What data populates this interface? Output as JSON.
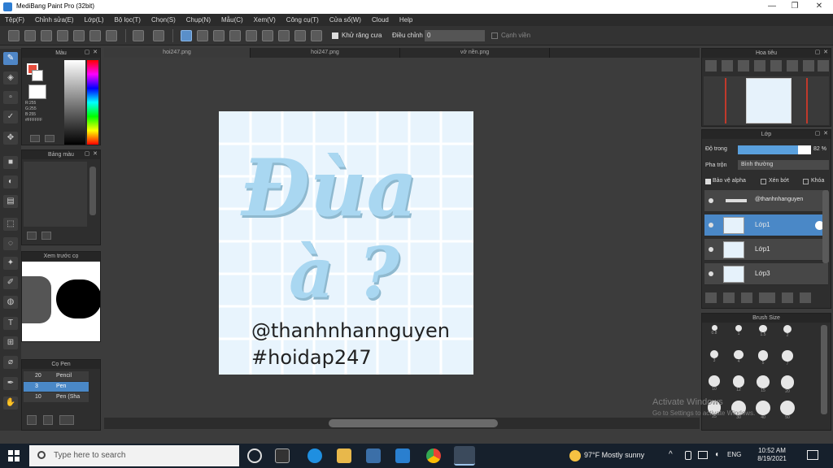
{
  "window": {
    "title": "MediBang Paint Pro (32bit)",
    "controls": [
      "—",
      "❐",
      "✕"
    ]
  },
  "menu": [
    "Tệp(F)",
    "Chỉnh sửa(E)",
    "Lớp(L)",
    "Bộ lọc(T)",
    "Chọn(S)",
    "Chụp(N)",
    "Mẫu(C)",
    "Xem(V)",
    "Công cụ(T)",
    "Cửa sổ(W)",
    "Cloud",
    "Help"
  ],
  "toolbar": {
    "fill_label": "Khử răng cưa",
    "correction_label": "Điều chỉnh",
    "correction_value": "0",
    "stroke_label": "Cạnh viền"
  },
  "tabs": [
    "hoi247.png",
    "hoi247.png",
    "vở nền.png"
  ],
  "color_panel": {
    "title": "Màu",
    "codes": [
      "R:255",
      "G:255",
      "B:255",
      "#FFFFFF"
    ]
  },
  "swatch_panel": {
    "title": "Bảng màu"
  },
  "preview_panel": {
    "title": "Xem trước cọ"
  },
  "brush_panel": {
    "title": "Cọ Pen",
    "items": [
      {
        "size": "20",
        "name": "Pencil"
      },
      {
        "size": "3",
        "name": "Pen"
      },
      {
        "size": "10",
        "name": "Pen (Sha"
      }
    ]
  },
  "navigator_panel": {
    "title": "Hoa tiêu"
  },
  "layer_panel": {
    "title": "Lớp",
    "opacity_label": "Độ trong",
    "opacity_value": "82 %",
    "opacity": 0.82,
    "blend_label": "Pha trộn",
    "blend_value": "Bình thường",
    "checks": [
      "Bảo vệ alpha",
      "Xén bớt",
      "Khóa"
    ],
    "layers": [
      "@thanhnhanguyen",
      "Lớp1",
      "Lớp1",
      "Lớp3"
    ]
  },
  "brush_size_panel": {
    "title": "Brush Size",
    "sizes": [
      "0.8",
      "1",
      "1.5",
      "2",
      "3",
      "4",
      "5",
      "7",
      "10",
      "12",
      "15",
      "20",
      "25",
      "30",
      "40",
      "50"
    ]
  },
  "canvas": {
    "word1": "Đùa",
    "word2": "à ?",
    "handle": "@thanhnhannguyen",
    "hashtag": "#hoidap247"
  },
  "watermark": {
    "line1": "Activate Windows",
    "line2": "Go to Settings to activate Windows."
  },
  "taskbar": {
    "search_placeholder": "Type here to search",
    "weather": "97°F  Mostly sunny",
    "lang": "ENG",
    "time": "10:52 AM",
    "date": "8/19/2021"
  },
  "colors": {
    "accent": "#4a88c7",
    "canvas_bg": "#e8f4fd",
    "lettering": "#a9d7f1"
  }
}
